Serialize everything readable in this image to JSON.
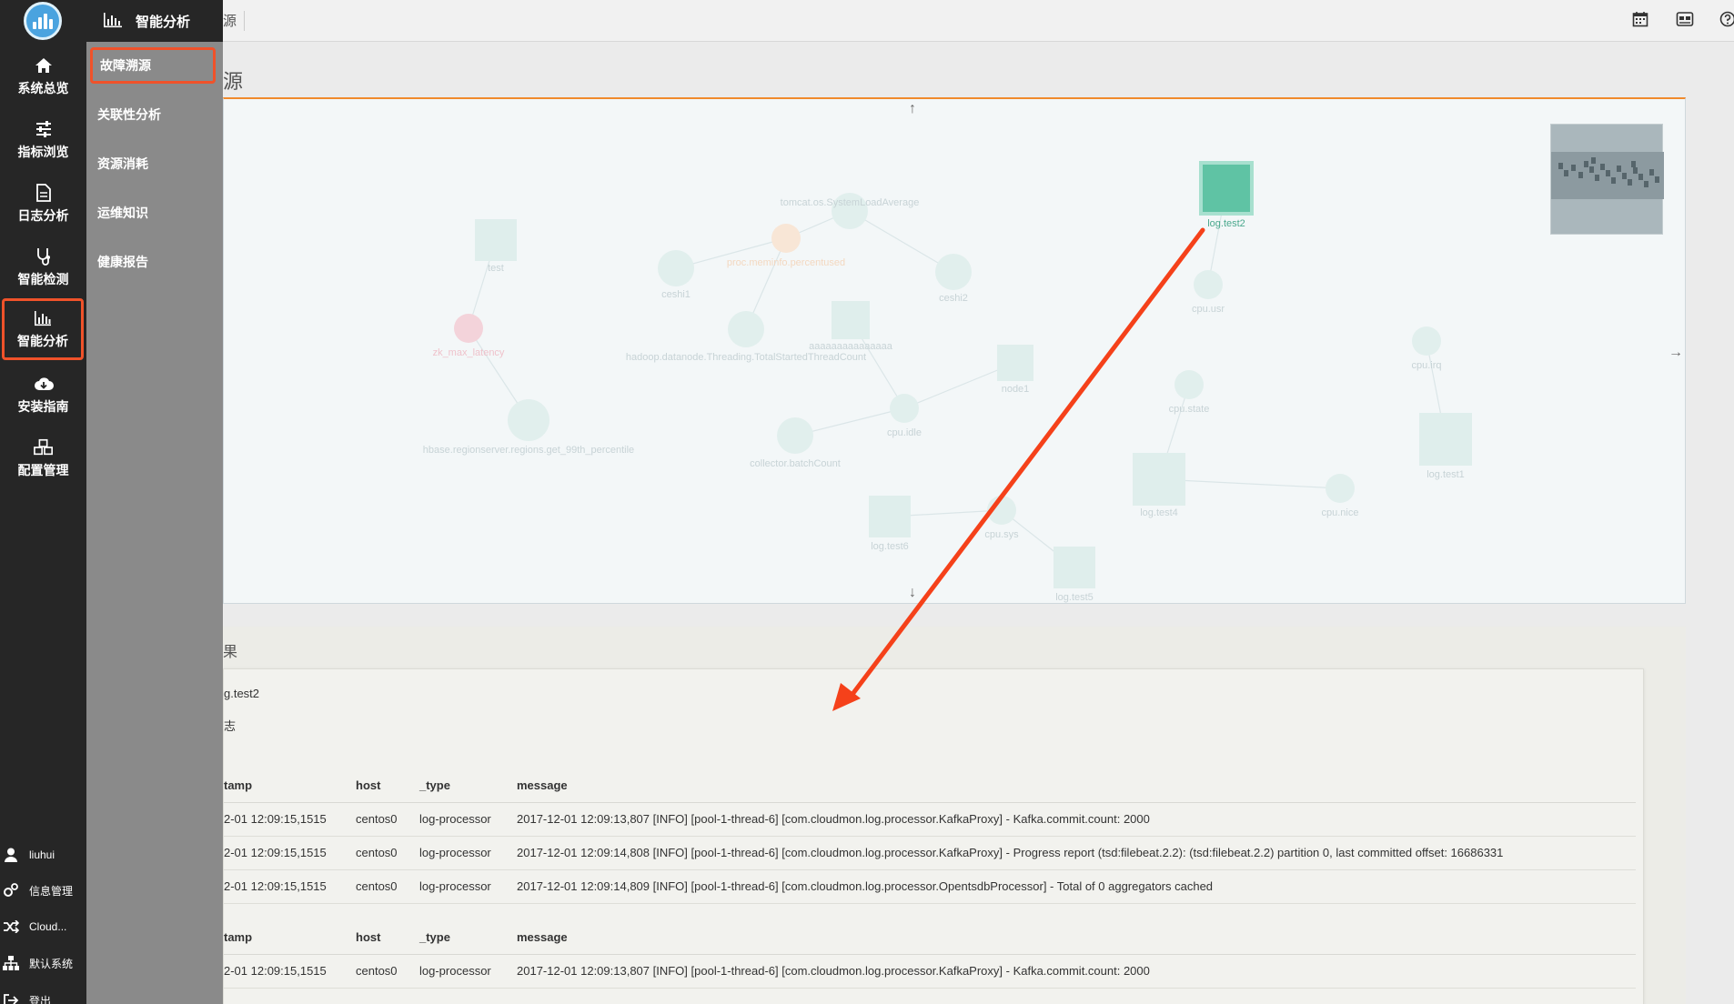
{
  "nav": {
    "items": [
      {
        "label": "系统总览",
        "icon": "home-icon"
      },
      {
        "label": "指标浏览",
        "icon": "sliders-icon"
      },
      {
        "label": "日志分析",
        "icon": "document-icon"
      },
      {
        "label": "智能检测",
        "icon": "stethoscope-icon"
      },
      {
        "label": "智能分析",
        "icon": "bar-chart-icon",
        "active": true
      },
      {
        "label": "安装指南",
        "icon": "cloud-download-icon"
      },
      {
        "label": "配置管理",
        "icon": "cubes-icon"
      }
    ],
    "bottom": [
      {
        "label": "liuhui",
        "icon": "user-icon"
      },
      {
        "label": "信息管理",
        "icon": "gears-icon"
      },
      {
        "label": "Cloud...",
        "icon": "shuffle-icon"
      },
      {
        "label": "默认系统",
        "icon": "sitemap-icon"
      },
      {
        "label": "登出",
        "icon": "logout-icon"
      }
    ]
  },
  "submenu": {
    "title": "智能分析",
    "items": [
      "故障溯源",
      "关联性分析",
      "资源消耗",
      "运维知识",
      "健康报告"
    ]
  },
  "main": {
    "top_fragment": "源",
    "page_fragment": "源",
    "graph_arrows": {
      "up": "↑",
      "right": "→",
      "down": "↓"
    },
    "graph_nodes": [
      {
        "label": "test"
      },
      {
        "label": "zk_max_latency"
      },
      {
        "label": "hbase.regionserver.regions.get_99th_percentile"
      },
      {
        "label": "ceshi1"
      },
      {
        "label": "tomcat.os.SystemLoadAverage"
      },
      {
        "label": "proc.meminfo.percentused"
      },
      {
        "label": "ceshi2"
      },
      {
        "label": "hadoop.datanode.Threading.TotalStartedThreadCount"
      },
      {
        "label": "aaaaaaaaaaaaaaa"
      },
      {
        "label": "cpu.idle"
      },
      {
        "label": "collector.batchCount"
      },
      {
        "label": "node1"
      },
      {
        "label": "log.test2"
      },
      {
        "label": "cpu.usr"
      },
      {
        "label": "cpu.state"
      },
      {
        "label": "cpu.irq"
      },
      {
        "label": "log.test1"
      },
      {
        "label": "log.test4"
      },
      {
        "label": "cpu.nice"
      },
      {
        "label": "log.test6"
      },
      {
        "label": "cpu.sys"
      },
      {
        "label": "log.test5"
      }
    ],
    "detail": {
      "section_fragment": "果",
      "node_value": "g.test2",
      "type_fragment": "志",
      "tables": [
        {
          "headers": [
            "tamp",
            "host",
            "_type",
            "message"
          ],
          "rows": [
            [
              "2-01 12:09:15,1515",
              "centos0",
              "log-processor",
              "2017-12-01 12:09:13,807 [INFO] [pool-1-thread-6] [com.cloudmon.log.processor.KafkaProxy] - Kafka.commit.count: 2000"
            ],
            [
              "2-01 12:09:15,1515",
              "centos0",
              "log-processor",
              "2017-12-01 12:09:14,808 [INFO] [pool-1-thread-6] [com.cloudmon.log.processor.KafkaProxy] - Progress report (tsd:filebeat.2.2): (tsd:filebeat.2.2) partition 0, last committed offset: 16686331"
            ],
            [
              "2-01 12:09:15,1515",
              "centos0",
              "log-processor",
              "2017-12-01 12:09:14,809 [INFO] [pool-1-thread-6] [com.cloudmon.log.processor.OpentsdbProcessor] - Total of 0 aggregators cached"
            ]
          ]
        },
        {
          "headers": [
            "tamp",
            "host",
            "_type",
            "message"
          ],
          "rows": [
            [
              "2-01 12:09:15,1515",
              "centos0",
              "log-processor",
              "2017-12-01 12:09:13,807 [INFO] [pool-1-thread-6] [com.cloudmon.log.processor.KafkaProxy] - Kafka.commit.count: 2000"
            ]
          ]
        }
      ]
    }
  },
  "colors": {
    "sidebar": "#262626",
    "submenu": "#8a8a8a",
    "highlight": "#f0522a",
    "node_selected": "#5fc3a4",
    "callout_arrow": "#f5411a"
  }
}
